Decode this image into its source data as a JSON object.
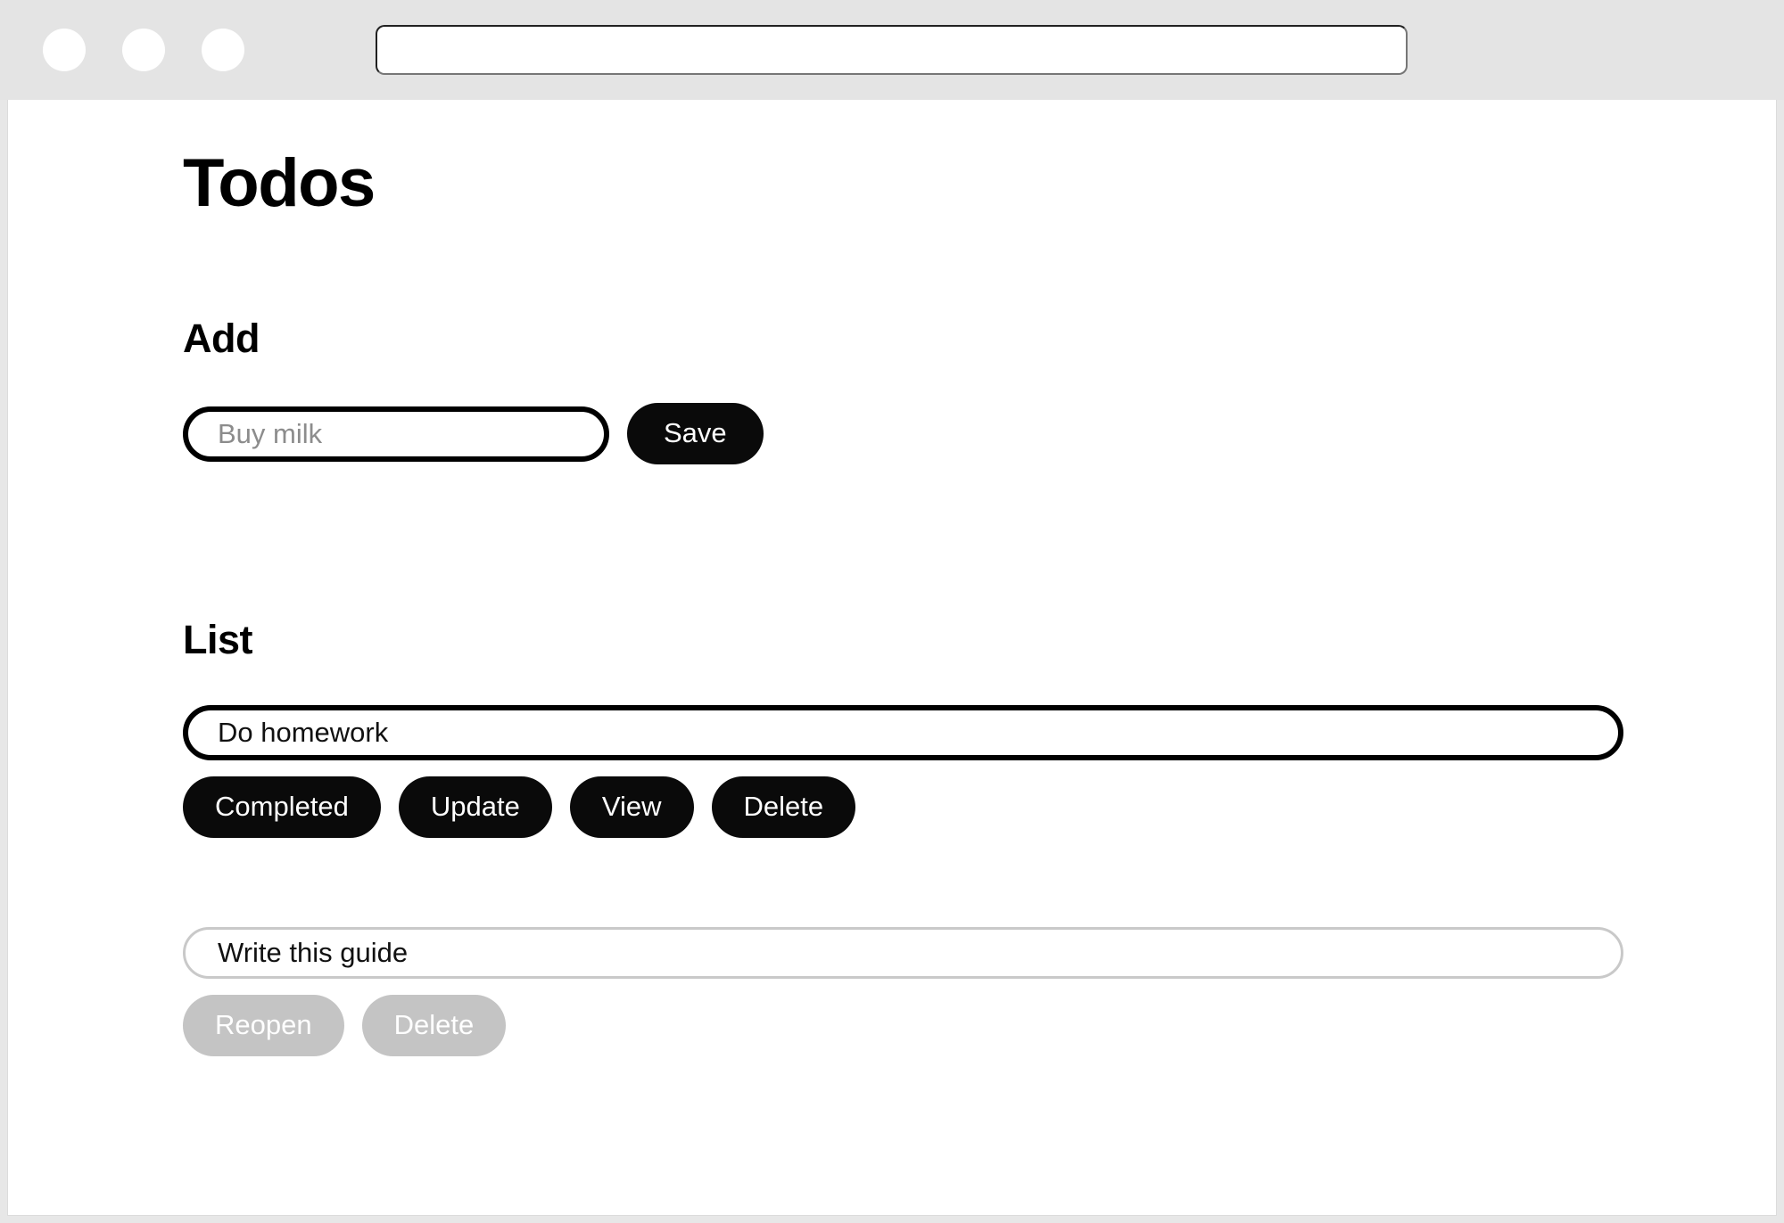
{
  "browser": {
    "traffic_lights": [
      "close-button",
      "minimize-button",
      "maximize-button"
    ],
    "address_bar_value": "",
    "address_bar_placeholder": ""
  },
  "page": {
    "title": "Todos"
  },
  "add_section": {
    "heading": "Add",
    "input_value": "",
    "input_placeholder": "Buy milk",
    "save_label": "Save"
  },
  "list_section": {
    "heading": "List",
    "items": [
      {
        "text": "Do homework",
        "state": "active",
        "actions": [
          {
            "label": "Completed",
            "style": "dark"
          },
          {
            "label": "Update",
            "style": "dark"
          },
          {
            "label": "View",
            "style": "dark"
          },
          {
            "label": "Delete",
            "style": "dark"
          }
        ]
      },
      {
        "text": "Write this guide",
        "state": "completed",
        "actions": [
          {
            "label": "Reopen",
            "style": "muted"
          },
          {
            "label": "Delete",
            "style": "muted"
          }
        ]
      }
    ]
  },
  "colors": {
    "chrome_background": "#e4e4e4",
    "page_background": "#ffffff",
    "accent_dark": "#0a0a0a",
    "muted": "#c4c4c4",
    "placeholder_text": "#8c8c8c",
    "body_text": "#111111",
    "completed_border": "#c9c9c9"
  }
}
